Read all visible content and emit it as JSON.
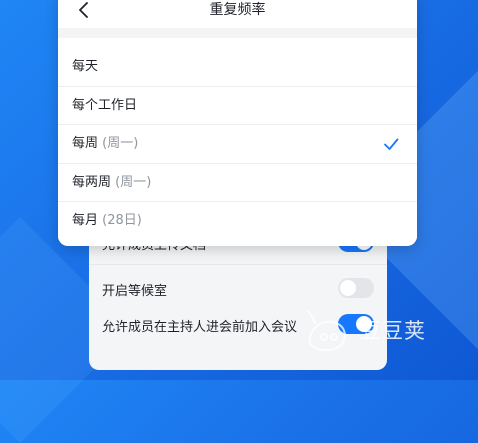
{
  "popup": {
    "title": "重复频率",
    "options": [
      {
        "label": "每天",
        "sub": "",
        "selected": false
      },
      {
        "label": "每个工作日",
        "sub": "",
        "selected": false
      },
      {
        "label": "每周",
        "sub": "(周一)",
        "selected": true
      },
      {
        "label": "每两周",
        "sub": "(周一)",
        "selected": false
      },
      {
        "label": "每月",
        "sub": "(28日)",
        "selected": false
      }
    ]
  },
  "settings": {
    "rows": [
      {
        "label": "允许成员上传文档",
        "on": true
      },
      {
        "label": "开启等候室",
        "on": false
      },
      {
        "label": "允许成员在主持人进会前加入会议",
        "on": true
      }
    ]
  },
  "watermark": {
    "text": "豆豆荚"
  },
  "colors": {
    "accent": "#1677ff",
    "background": "#1a6fe6"
  }
}
